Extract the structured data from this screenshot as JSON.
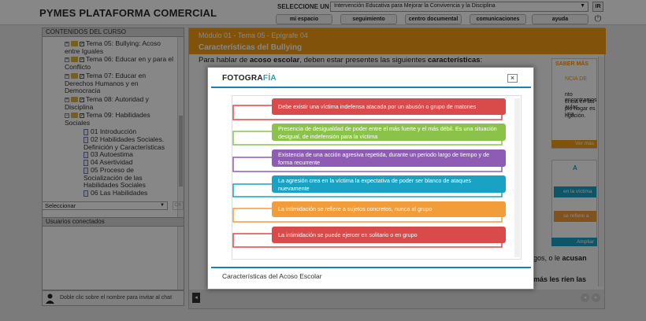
{
  "header": {
    "brand": "PYMES PLATAFORMA COMERCIAL",
    "course_label": "SELECCIONE UN CURSO:",
    "course_value": "Intervención Educativa para Mejorar la Convivencia y la Disciplina",
    "go": "IR",
    "nav": [
      "mi espacio",
      "seguimiento",
      "centro documental",
      "comunicaciones",
      "ayuda"
    ]
  },
  "sidebar": {
    "title": "CONTENIDOS DEL CURSO",
    "items": [
      {
        "label": "Tema 05: Bullying: Acoso entre Iguales"
      },
      {
        "label": "Tema 06: Educar en y para el Conflicto"
      },
      {
        "label": "Tema 07: Educar en Derechos Humanos y en Democracia"
      },
      {
        "label": "Tema 08: Autoridad y Disciplina"
      },
      {
        "label": "Tema 09: Habilidades Sociales"
      },
      {
        "label": "01 Introducción"
      },
      {
        "label": "02 Habilidades Sociales. Definición y Características"
      },
      {
        "label": "03 Autoestima"
      },
      {
        "label": "04 Asertividad"
      },
      {
        "label": "05 Proceso de Socialización de las Habilidades Sociales"
      },
      {
        "label": "06 Las Habilidades"
      }
    ],
    "select": "Seleccionar",
    "ok": "OK",
    "users_title": "Usuarios conectados",
    "chat_hint": "Doble clic sobre el nombre para invitar al chat"
  },
  "main": {
    "breadcrumb": "Módulo 01 - Tema 05 - Epígrafe 04",
    "title": "Características del Bullying",
    "intro_a": "Para hablar de ",
    "intro_b": "acoso escolar",
    "intro_c": ", deben estar presentes las siguientes ",
    "intro_d": "características",
    "side_a": "SABER MÁS",
    "side_b": "NCIA DE",
    "side_c": "nto encontramos",
    "side_d": "encia en las aulas,",
    "side_e": "pio hogar es una",
    "side_f": "ngación.",
    "ver_mas": "Ver más",
    "side2_a": "A",
    "side2_b": "en la víctima la",
    "side2_c": "se refiere a suje",
    "ampliar": "Ampliar",
    "frag1": "gos, o le",
    "frag1b": "acusan",
    "frag2": "más les ríen las"
  },
  "modal": {
    "logo_a": "FOTOGRA",
    "logo_b": "FÍA",
    "close": "×",
    "caption": "Características del Acoso Escolar",
    "items": [
      {
        "text": "Debe existir una víctima indefensa atacada por un abusón o grupo de matones",
        "color": "#d94a4a"
      },
      {
        "text": "Presencia de desigualdad de poder entre el más fuerte y el más débil. Es una situación desigual, de indefensión para la víctima",
        "color": "#8bc34a"
      },
      {
        "text": "Existencia de una acción agresiva repetida, durante un periodo largo de tiempo y de forma recurrente",
        "color": "#8e5bb5"
      },
      {
        "text": "La agresión crea en la víctima la expectativa de poder ser blanco de ataques nuevamente",
        "color": "#1aa2c4"
      },
      {
        "text": "La intimidación se refiere a sujetos concretos, nunca al grupo",
        "color": "#f39c3a"
      },
      {
        "text": "La intimidación se puede ejercer en solitario o en grupo",
        "color": "#d94a4a"
      }
    ]
  }
}
